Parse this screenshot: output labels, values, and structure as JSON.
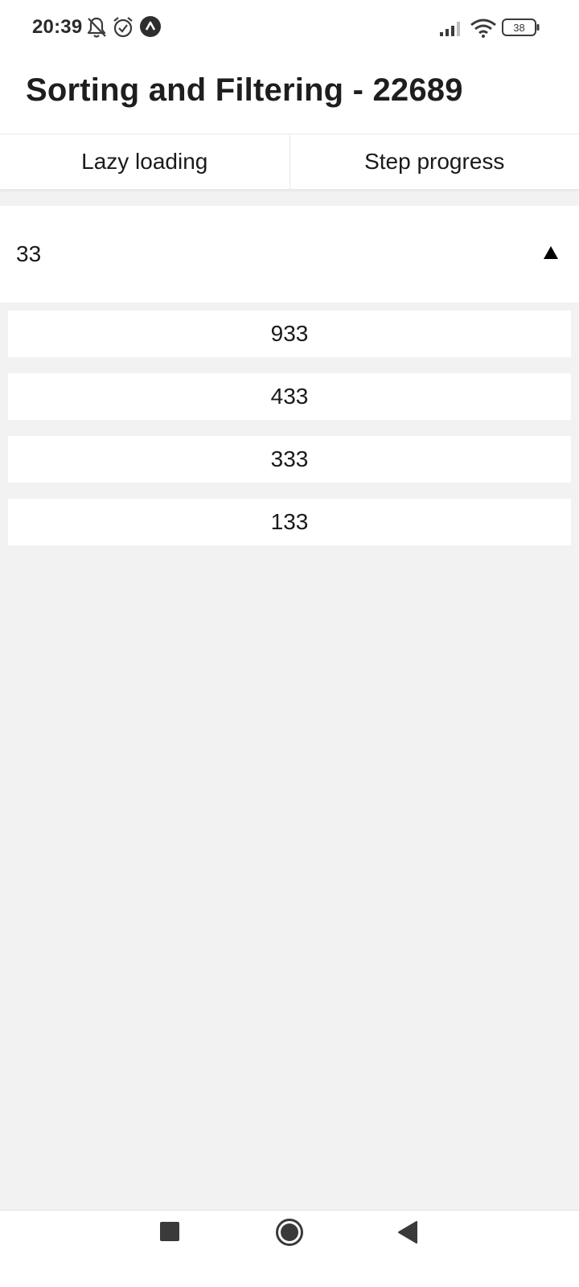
{
  "status_bar": {
    "time": "20:39",
    "battery": "38",
    "icons": [
      "notifications-off-icon",
      "alarm-icon",
      "app-notification-icon",
      "signal-icon",
      "wifi-icon",
      "battery-icon"
    ]
  },
  "header": {
    "title": "Sorting and Filtering - 22689"
  },
  "tabs": [
    {
      "label": "Lazy loading"
    },
    {
      "label": "Step progress"
    }
  ],
  "select": {
    "value": "33",
    "arrow_icon": "triangle-up-icon",
    "options": [
      {
        "label": "933"
      },
      {
        "label": "433"
      },
      {
        "label": "333"
      },
      {
        "label": "133"
      }
    ]
  },
  "nav_bar": {
    "icons": [
      "recents-square-icon",
      "home-circle-icon",
      "back-triangle-icon"
    ]
  },
  "colors": {
    "background": "#f2f2f2",
    "surface": "#ffffff",
    "text": "#1a1a1a"
  }
}
